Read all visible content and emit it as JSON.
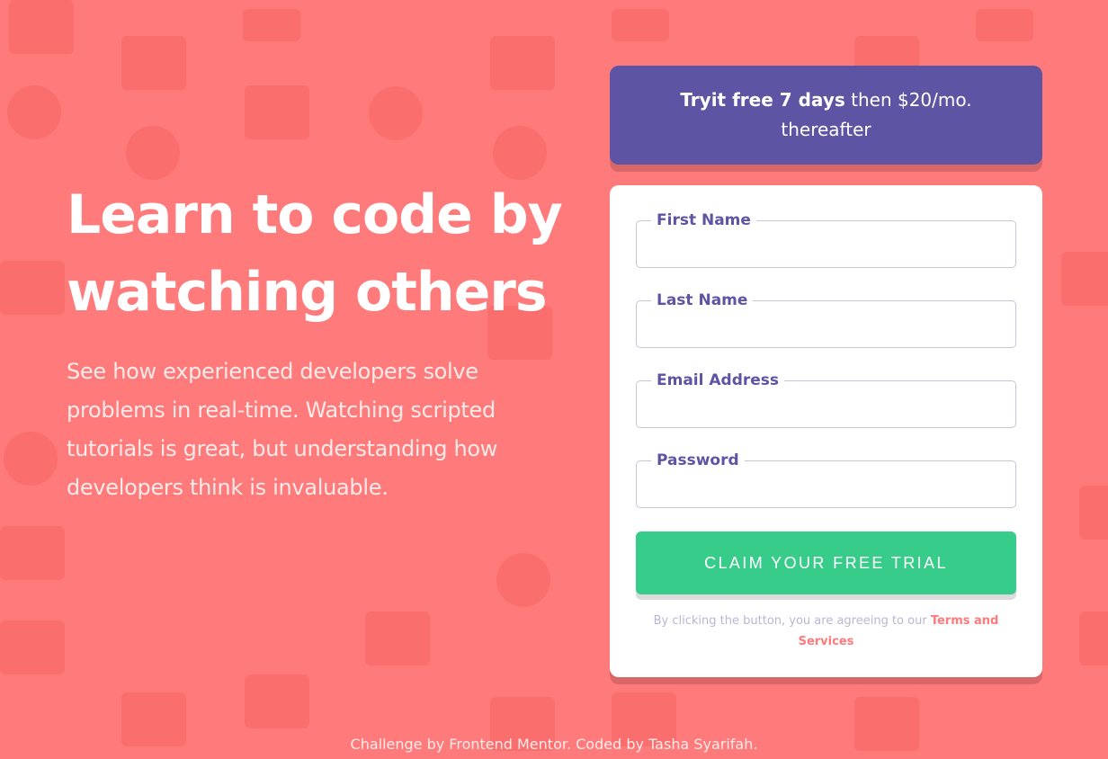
{
  "colors": {
    "background": "#ff7a7a",
    "promo": "#5e54a4",
    "cta": "#38cc8b",
    "label": "#5e54a4",
    "link": "#ff7a7a"
  },
  "hero": {
    "title": "Learn to code by watching others",
    "description": "See how experienced developers solve problems in real-time. Watching scripted tutorials is great, but understanding how developers think is invaluable."
  },
  "promo": {
    "bold": "Tryit free 7 days",
    "rest": " then $20/mo. thereafter"
  },
  "form": {
    "fields": [
      {
        "label": "First Name",
        "value": ""
      },
      {
        "label": "Last Name",
        "value": ""
      },
      {
        "label": "Email Address",
        "value": ""
      },
      {
        "label": "Password",
        "value": ""
      }
    ],
    "submit_label": "CLAIM YOUR FREE TRIAL",
    "terms_text": "By clicking the button, you are agreeing to our ",
    "terms_link": "Terms and Services"
  },
  "footer": {
    "text": "Challenge by Frontend Mentor. Coded by Tasha Syarifah."
  },
  "icons": [
    "web-page-icon",
    "headset-icon",
    "network-icon",
    "rocket-icon",
    "gear-icon",
    "bar-chart-icon",
    "magnet-icon",
    "lightbulb-icon",
    "toolbox-icon"
  ]
}
